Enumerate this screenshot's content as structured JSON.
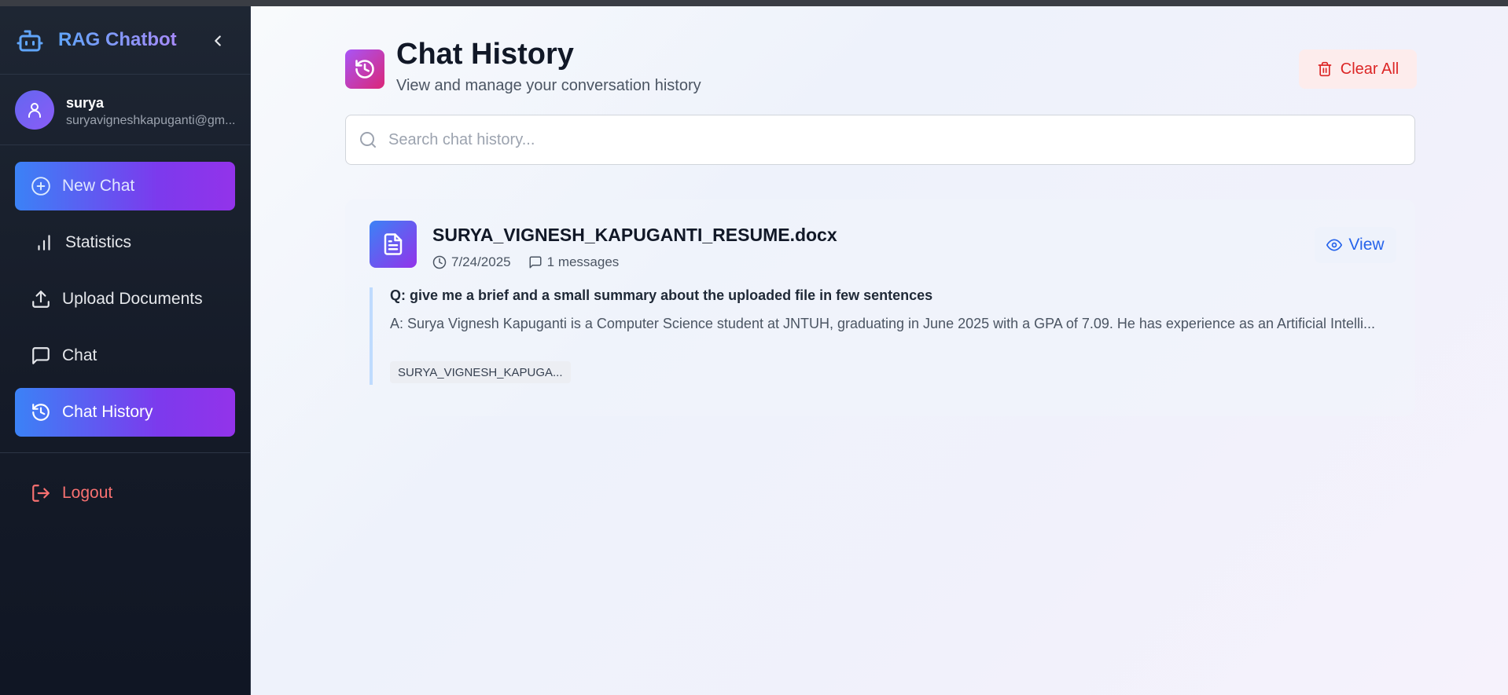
{
  "app": {
    "title": "RAG Chatbot"
  },
  "user": {
    "name": "surya",
    "email": "suryavigneshkapuganti@gm..."
  },
  "nav": {
    "new_chat": "New Chat",
    "statistics": "Statistics",
    "upload": "Upload Documents",
    "chat": "Chat",
    "chat_history": "Chat History",
    "logout": "Logout"
  },
  "header": {
    "title": "Chat History",
    "subtitle": "View and manage your conversation history",
    "clear_all": "Clear All"
  },
  "search": {
    "placeholder": "Search chat history...",
    "value": ""
  },
  "history": [
    {
      "file_name": "SURYA_VIGNESH_KAPUGANTI_RESUME.docx",
      "date": "7/24/2025",
      "messages": "1 messages",
      "view_label": "View",
      "question": "Q: give me a brief and a small summary about the uploaded file in few sentences",
      "answer": "A: Surya Vignesh Kapuganti is a Computer Science student at JNTUH, graduating in June 2025 with a GPA of 7.09. He has experience as an Artificial Intelli...",
      "tag": "SURYA_VIGNESH_KAPUGA..."
    }
  ],
  "colors": {
    "accent_gradient_start": "#3b82f6",
    "accent_gradient_end": "#9333ea",
    "danger": "#dc2626",
    "link": "#2563eb"
  }
}
